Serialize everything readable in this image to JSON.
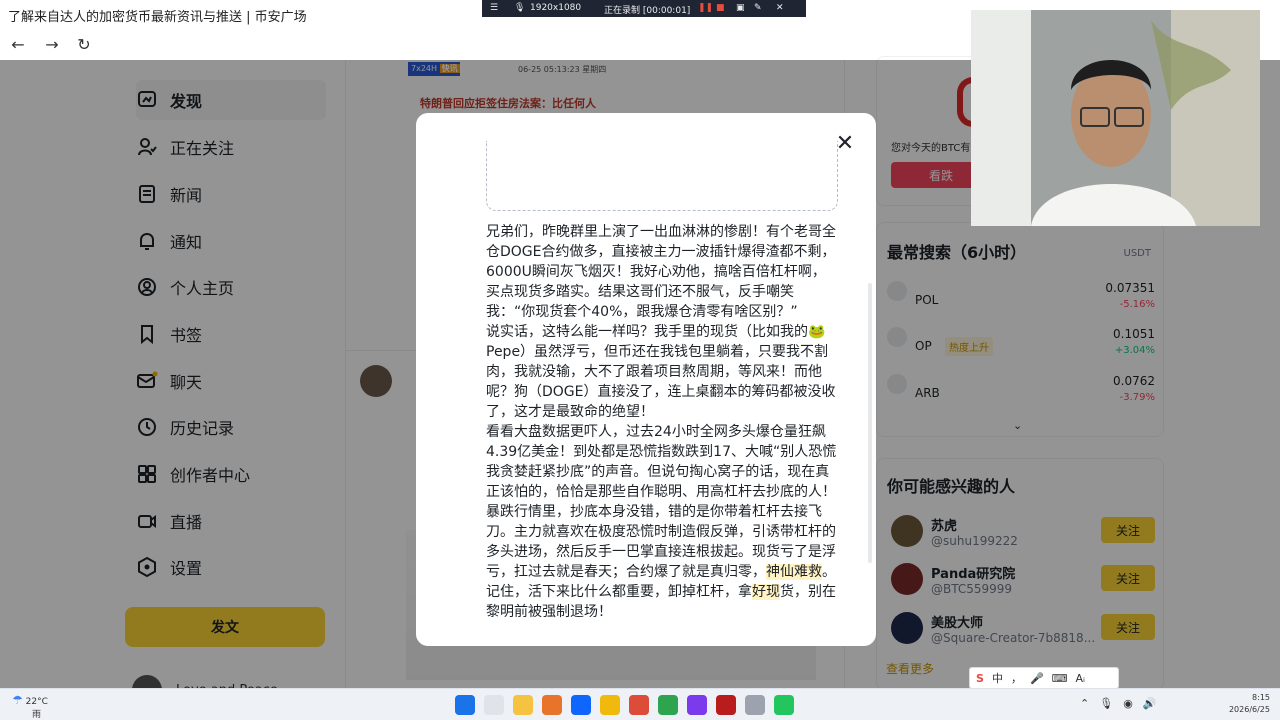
{
  "browser": {
    "title": "了解来自达人的加密货币最新资讯与推送 | 币安广场",
    "recording": {
      "resolution": "1920x1080",
      "status": "正在录制 [00:00:01]"
    }
  },
  "sidebar": {
    "items": [
      {
        "label": "发现",
        "icon": "discover-icon"
      },
      {
        "label": "正在关注",
        "icon": "following-icon"
      },
      {
        "label": "新闻",
        "icon": "news-icon"
      },
      {
        "label": "通知",
        "icon": "bell-icon"
      },
      {
        "label": "个人主页",
        "icon": "profile-icon"
      },
      {
        "label": "书签",
        "icon": "bookmark-icon"
      },
      {
        "label": "聊天",
        "icon": "chat-icon"
      },
      {
        "label": "历史记录",
        "icon": "history-icon"
      },
      {
        "label": "创作者中心",
        "icon": "creator-icon"
      },
      {
        "label": "直播",
        "icon": "live-icon"
      },
      {
        "label": "设置",
        "icon": "settings-icon"
      }
    ],
    "post_button": "发文",
    "user_name": "Love and Peace"
  },
  "feed": {
    "news_tag": "7x24H",
    "news_tag2": "快讯",
    "news_date": "06-25 05:13:23 星期四",
    "news_title": "特朗普回应拒签住房法案：比任何人"
  },
  "modal": {
    "paragraphs": [
      "兄弟们，昨晚群里上演了一出血淋淋的惨剧！有个老哥全仓DOGE合约做多，直接被主力一波插针爆得渣都不剩，6000U瞬间灰飞烟灭！我好心劝他，搞啥百倍杠杆啊，买点现货多踏实。结果这哥们还不服气，反手嘲笑我：“你现货套个40%，跟我爆仓清零有啥区别？”",
      "说实话，这特么能一样吗？我手里的现货（比如我的🐸Pepe）虽然浮亏，但币还在我钱包里躺着，只要我不割肉，我就没输，大不了跟着项目熬周期，等风来！而他呢？狗（DOGE）直接没了，连上桌翻本的筹码都被没收了，这才是最致命的绝望！",
      "看看大盘数据更吓人，过去24小时全网多头爆仓量狂飙4.39亿美金！到处都是恐慌指数跌到17、大喊“别人恐慌我贪婪赶紧抄底”的声音。但说句掏心窝子的话，现在真正该怕的，恰恰是那些自作聪明、用高杠杆去抄底的人！",
      "暴跌行情里，抄底本身没错，错的是你带着杠杆去接飞刀。主力就喜欢在极度恐慌时制造假反弹，引诱带杠杆的多头进场，然后反手一巴掌直接连根拔起。现货亏了是浮亏，扛过去就是春天；合约爆了就是真归零，",
      "神仙难救",
      "。记住，活下来比什么都重要，卸掉杠杆，拿",
      "好现",
      "货，别在黎明前被强制退场！"
    ]
  },
  "right": {
    "poll_question": "您对今天的BTC有何",
    "poll_button": "看跌",
    "hot_search_title": "最常搜索（6小时）",
    "currency": "USDT",
    "coins": [
      {
        "name": "POL",
        "price": "0.07351",
        "change": "-5.16%",
        "dir": "down",
        "hot": ""
      },
      {
        "name": "OP",
        "price": "0.1051",
        "change": "+3.04%",
        "dir": "up",
        "hot": "热度上升"
      },
      {
        "name": "ARB",
        "price": "0.0762",
        "change": "-3.79%",
        "dir": "down",
        "hot": ""
      }
    ],
    "people_title": "你可能感兴趣的人",
    "people": [
      {
        "name": "苏虎",
        "handle": "@suhu199222",
        "button": "关注",
        "color": "#6b5a3a"
      },
      {
        "name": "Panda研究院",
        "handle": "@BTC559999",
        "button": "关注",
        "color": "#7a2a2a"
      },
      {
        "name": "美股大师",
        "handle": "@Square-Creator-7b8818...",
        "button": "关注",
        "color": "#1e2a4a"
      }
    ],
    "see_more": "查看更多"
  },
  "taskbar": {
    "temp": "22°C",
    "weather": "雨",
    "time": "8:15",
    "date": "2026/6/25",
    "ime": [
      "中",
      "，",
      "🎤",
      "⌨",
      "Aᵢ"
    ]
  }
}
